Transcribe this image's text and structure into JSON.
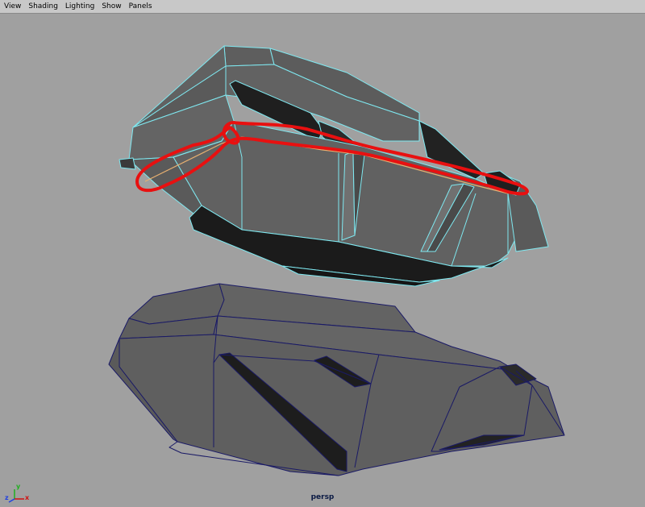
{
  "menubar": {
    "items": [
      "View",
      "Shading",
      "Lighting",
      "Show",
      "Panels"
    ]
  },
  "viewport": {
    "camera_label": "persp",
    "background": "#a0a0a0",
    "selection_wire_color": "#7fe8f0",
    "unselected_wire_color": "#1a1a66",
    "selected_edge_color": "#e8b070",
    "annotation_color": "#e81010"
  },
  "axis": {
    "x": "x",
    "y": "y",
    "z": "z",
    "x_color": "#d01010",
    "y_color": "#20b020",
    "z_color": "#2040e0"
  }
}
